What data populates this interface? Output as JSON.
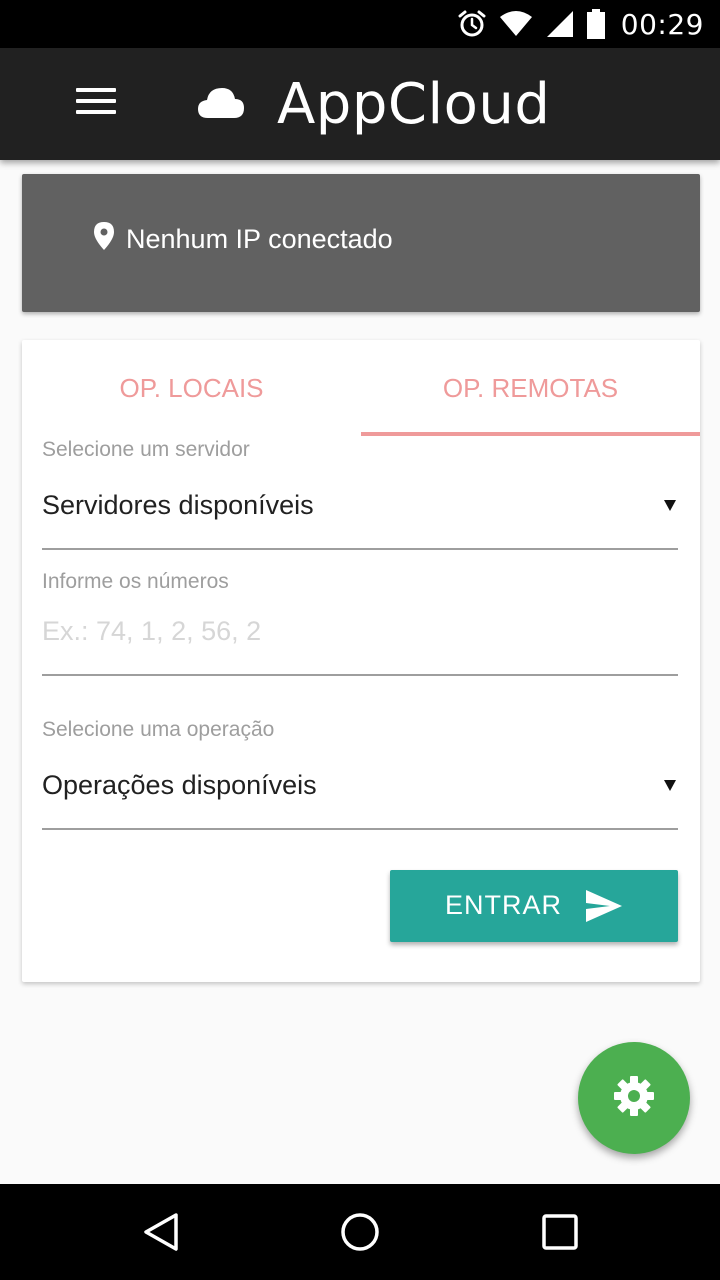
{
  "status_bar": {
    "time": "00:29",
    "icons": [
      "alarm-icon",
      "wifi-icon",
      "signal-icon",
      "battery-icon"
    ]
  },
  "app_bar": {
    "title": "AppCloud",
    "menu_icon": "hamburger-menu-icon",
    "logo_icon": "cloud-icon"
  },
  "ip_card": {
    "icon": "location-pin-icon",
    "text": "Nenhum IP conectado"
  },
  "tabs": [
    {
      "label": "OP. LOCAIS",
      "selected": false
    },
    {
      "label": "OP. REMOTAS",
      "selected": true
    }
  ],
  "form": {
    "server_label": "Selecione um servidor",
    "server_value": "Servidores disponíveis",
    "numbers_label": "Informe os números",
    "numbers_value": "",
    "numbers_placeholder": "Ex.: 74, 1, 2, 56, 2",
    "operation_label": "Selecione uma operação",
    "operation_value": "Operações disponíveis",
    "submit_label": "ENTRAR",
    "submit_icon": "send-icon"
  },
  "fab": {
    "icon": "gear-icon"
  },
  "nav_bar": {
    "buttons": [
      "back-icon",
      "home-icon",
      "recents-icon"
    ]
  },
  "colors": {
    "app_bar": "#212121",
    "ip_card": "#616161",
    "tab_accent": "#ef9a9a",
    "button": "#26a69a",
    "fab": "#4caf50"
  }
}
